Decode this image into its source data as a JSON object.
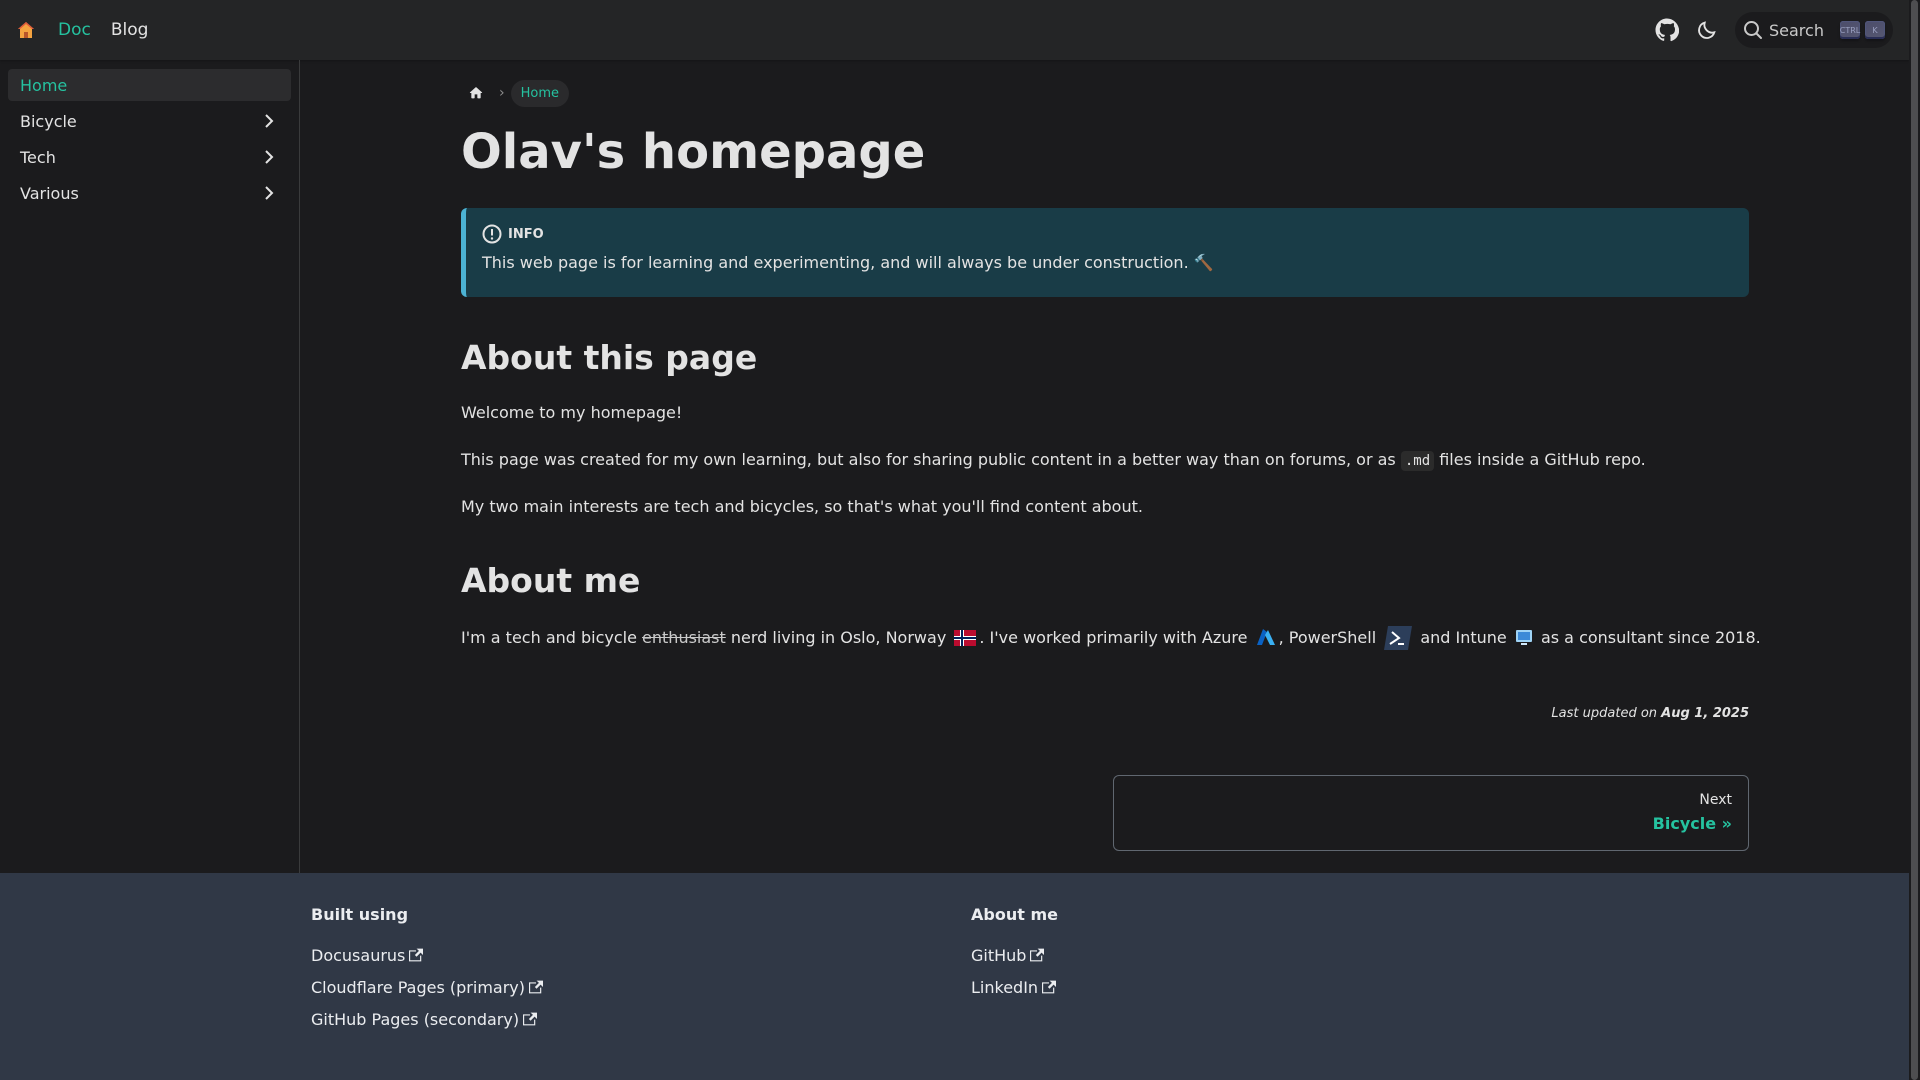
{
  "navbar": {
    "logo_icon": "home-icon",
    "links": [
      {
        "label": "Doc",
        "active": true
      },
      {
        "label": "Blog",
        "active": false
      }
    ],
    "github_icon": "github-icon",
    "theme_icon": "moon-icon",
    "search": {
      "placeholder": "Search",
      "keys": [
        "CTRL",
        "K"
      ]
    }
  },
  "sidebar": {
    "items": [
      {
        "label": "Home",
        "active": true,
        "expandable": false
      },
      {
        "label": "Bicycle",
        "active": false,
        "expandable": true
      },
      {
        "label": "Tech",
        "active": false,
        "expandable": true
      },
      {
        "label": "Various",
        "active": false,
        "expandable": true
      }
    ]
  },
  "breadcrumb": {
    "current": "Home"
  },
  "page": {
    "title": "Olav's homepage",
    "info": {
      "heading": "INFO",
      "text": "This web page is for learning and experimenting, and will always be under construction. 🔨"
    },
    "section1": {
      "heading": "About this page",
      "p1": "Welcome to my homepage!",
      "p2_before": "This page was created for my own learning, but also for sharing public content in a better way than on forums, or as ",
      "p2_code": ".md",
      "p2_after": " files inside a GitHub repo.",
      "p3": "My two main interests are tech and bicycles, so that's what you'll find content about."
    },
    "section2": {
      "heading": "About me",
      "t1": "I'm a tech and bicycle ",
      "strike": "enthusiast",
      "t2": " nerd living in Oslo, Norway ",
      "t3": ". I've worked primarily with Azure ",
      "t4": ", PowerShell ",
      "t5": " and Intune ",
      "t6": " as a consultant since 2018."
    },
    "last_updated_label": "Last updated on",
    "last_updated_date": "Aug 1, 2025",
    "pager": {
      "sub": "Next",
      "label": "Bicycle »"
    }
  },
  "footer": {
    "col1": {
      "title": "Built using",
      "links": [
        "Docusaurus",
        "Cloudflare Pages (primary)",
        "GitHub Pages (secondary)"
      ]
    },
    "col2": {
      "title": "About me",
      "links": [
        "GitHub",
        "LinkedIn"
      ]
    }
  },
  "colors": {
    "accent": "#25c2a0",
    "info_bg": "#193c47",
    "info_border": "#4cb3d4",
    "footer_bg": "#303846"
  }
}
